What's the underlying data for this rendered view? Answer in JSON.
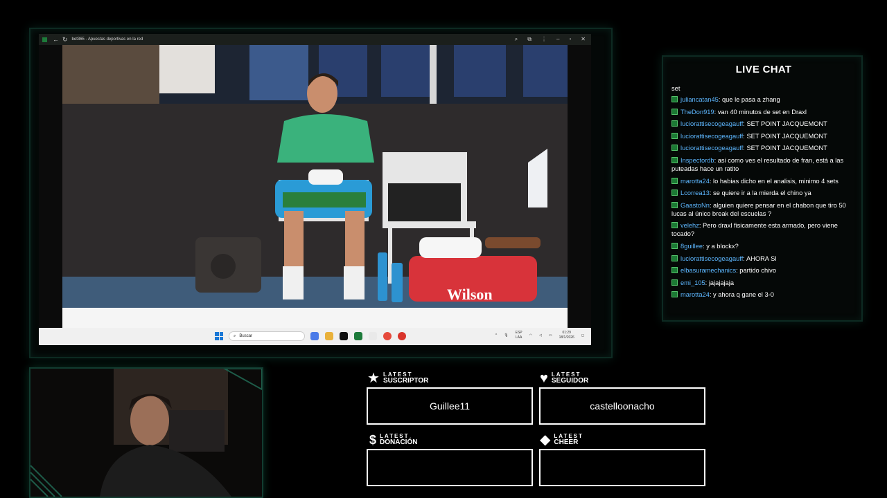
{
  "window": {
    "title": "bet365 - Apuestas deportivas en la red",
    "nav_back": "←",
    "nav_reload": "↻",
    "controls": [
      "⌕",
      "⧉",
      "⋮",
      "–",
      "▫",
      "✕"
    ]
  },
  "taskbar": {
    "search_placeholder": "Buscar",
    "lang_top": "ESP",
    "lang_bottom": "LAA",
    "time": "01:29",
    "date": "18/1/2026",
    "app_colors": [
      "#4b7be8",
      "#e9b13b",
      "#111111",
      "#1d7a3a",
      "#e9e9e9",
      "#e64a3c",
      "#d9342b"
    ]
  },
  "chat": {
    "title": "LIVE CHAT",
    "partial_line": "set",
    "messages": [
      {
        "user": "juliancatan45",
        "text": "que le pasa a zhang"
      },
      {
        "user": "TheDon919",
        "text": "van 40 minutos de set en Draxl"
      },
      {
        "user": "luciorattisecogeagauff",
        "text": "SET POINT JACQUEMONT"
      },
      {
        "user": "luciorattisecogeagauff",
        "text": "SET POINT JACQUEMONT"
      },
      {
        "user": "luciorattisecogeagauff",
        "text": "SET POINT JACQUEMONT"
      },
      {
        "user": "Inspectordb",
        "text": "asi como ves el resultado de fran, está a las puteadas hace un ratito"
      },
      {
        "user": "marotta24",
        "text": "lo habias dicho en el analisis, minimo 4 sets"
      },
      {
        "user": "Lcorrea13",
        "text": "se quiere ir a la mierda el chino ya"
      },
      {
        "user": "GaastoNn",
        "text": "alguien quiere pensar en el chabon que tiro 50 lucas al único break del escuelas ?"
      },
      {
        "user": "velehz",
        "text": "Pero draxl fisicamente esta armado, pero viene tocado?"
      },
      {
        "user": "8guillee",
        "text": "y a blockx?"
      },
      {
        "user": "luciorattisecogeagauff",
        "text": "AHORA SI"
      },
      {
        "user": "elbasuramechanics",
        "text": "partido chivo"
      },
      {
        "user": "emi_105",
        "text": "jajajajaja"
      },
      {
        "user": "marotta24",
        "text": "y ahora q gane el 3-0"
      }
    ]
  },
  "alerts": {
    "sub": {
      "small": "LATEST",
      "big": "SUSCRIPTOR",
      "value": "Guillee11"
    },
    "follower": {
      "small": "LATEST",
      "big": "SEGUIDOR",
      "value": "castelloonacho"
    },
    "donation": {
      "small": "LATEST",
      "big": "DONACIÓN",
      "value": ""
    },
    "cheer": {
      "small": "LATEST",
      "big": "CHEER",
      "value": ""
    }
  },
  "colors": {
    "accent_green": "#0d2a22",
    "chat_username": "#5db7ff",
    "badge_green": "#1c7a34"
  }
}
